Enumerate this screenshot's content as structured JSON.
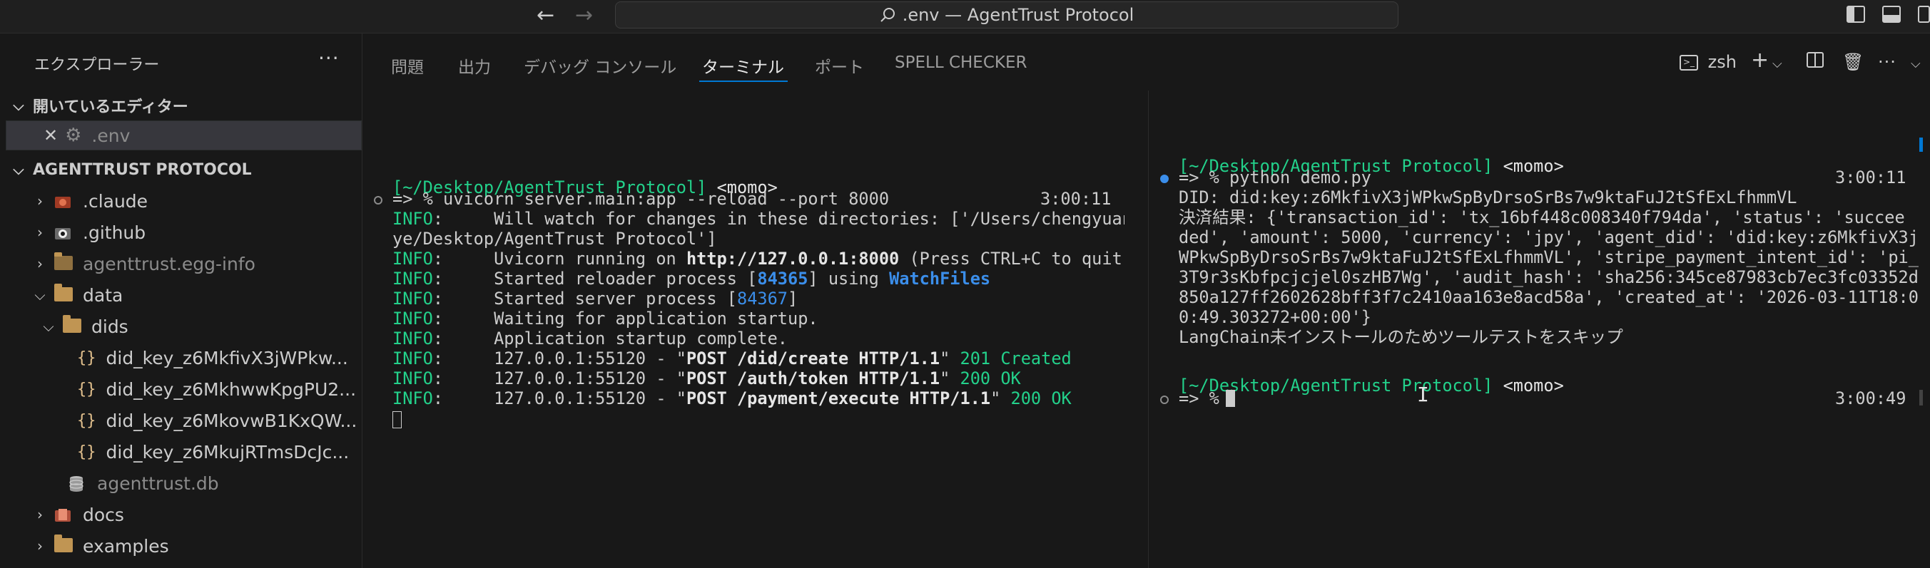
{
  "window": {
    "title": ".env — AgentTrust Protocol"
  },
  "sidebar": {
    "header": "エクスプローラー",
    "open_editors_label": "開いているエディター",
    "open_editor_file": ".env",
    "project_label": "AGENTTRUST PROTOCOL",
    "items": [
      {
        "label": ".claude",
        "kind": "folder",
        "expanded": false
      },
      {
        "label": ".github",
        "kind": "folder",
        "expanded": false
      },
      {
        "label": "agenttrust.egg-info",
        "kind": "folder",
        "expanded": false
      },
      {
        "label": "data",
        "kind": "folder",
        "expanded": true
      },
      {
        "label": "dids",
        "kind": "folder",
        "expanded": true
      },
      {
        "label": "did_key_z6MkfivX3jWPkw...",
        "kind": "json"
      },
      {
        "label": "did_key_z6MkhwwKpgPU2...",
        "kind": "json"
      },
      {
        "label": "did_key_z6MkovwB1KxQW...",
        "kind": "json"
      },
      {
        "label": "did_key_z6MkujRTmsDcJc...",
        "kind": "json"
      },
      {
        "label": "agenttrust.db",
        "kind": "db"
      },
      {
        "label": "docs",
        "kind": "folder",
        "expanded": false
      },
      {
        "label": "examples",
        "kind": "folder",
        "expanded": false
      }
    ]
  },
  "panel": {
    "tabs": [
      "問題",
      "出力",
      "デバッグ コンソール",
      "ターミナル",
      "ポート",
      "SPELL CHECKER"
    ],
    "active_tab": "ターミナル",
    "shell_label": "zsh"
  },
  "terminal_left": {
    "prompt_path": "[~/Desktop/AgentTrust Protocol]",
    "prompt_user": "<momo>",
    "command": "=> % uvicorn server.main:app --reload --port 8000",
    "command_time": "3:00:11",
    "lines": [
      {
        "level": "INFO",
        "text": "Will watch for changes in these directories: ['/Users/chengyuan"
      },
      {
        "level": "",
        "text": "ye/Desktop/AgentTrust Protocol']"
      },
      {
        "level": "INFO",
        "pre": "Uvicorn running on ",
        "bold": "http://127.0.0.1:8000",
        "post": " (Press CTRL+C to quit)"
      },
      {
        "level": "INFO",
        "pre": "Started reloader process [",
        "cyan": "84365",
        "post": "] using ",
        "cyan2": "WatchFiles"
      },
      {
        "level": "INFO",
        "pre": "Started server process [",
        "cyan": "84367",
        "post": "]"
      },
      {
        "level": "INFO",
        "text": "Waiting for application startup."
      },
      {
        "level": "INFO",
        "text": "Application startup complete."
      },
      {
        "level": "INFO",
        "pre": "127.0.0.1:55120 - \"",
        "bold": "POST /did/create HTTP/1.1",
        "post": "\" ",
        "status": "201 Created"
      },
      {
        "level": "INFO",
        "pre": "127.0.0.1:55120 - \"",
        "bold": "POST /auth/token HTTP/1.1",
        "post": "\" ",
        "status": "200 OK"
      },
      {
        "level": "INFO",
        "pre": "127.0.0.1:55120 - \"",
        "bold": "POST /payment/execute HTTP/1.1",
        "post": "\" ",
        "status": "200 OK"
      }
    ]
  },
  "terminal_right": {
    "prompt_path": "[~/Desktop/AgentTrust Protocol]",
    "prompt_user": "<momo>",
    "command": "=> % python demo.py",
    "command_time": "3:00:11",
    "output": [
      "DID: did:key:z6MkfivX3jWPkwSpByDrsoSrBs7w9ktaFuJ2tSfExLfhmmVL",
      "決済結果: {'transaction_id': 'tx_16bf448c008340f794da', 'status': 'succee",
      "ded', 'amount': 5000, 'currency': 'jpy', 'agent_did': 'did:key:z6MkfivX3j",
      "WPkwSpByDrsoSrBs7w9ktaFuJ2tSfExLfhmmVL', 'stripe_payment_intent_id': 'pi_",
      "3T9r3sKbfpcjcjel0szHB7Wg', 'audit_hash': 'sha256:345ce87983cb7ec3fc03352d",
      "850a127ff2602628bff3f7c2410aa163e8acd58a', 'created_at': '2026-03-11T18:0",
      "0:49.303272+00:00'}",
      "LangChain未インストールのためツールテストをスキップ"
    ],
    "prompt2_path": "[~/Desktop/AgentTrust Protocol]",
    "prompt2_user": "<momo>",
    "prompt2": "=> %",
    "prompt2_time": "3:00:49"
  },
  "colors": {
    "accent": "#0078d4",
    "terminal_green": "#23d18b",
    "terminal_cyan": "#3b8eea",
    "folder": "#c09553",
    "json": "#e2c08d"
  }
}
